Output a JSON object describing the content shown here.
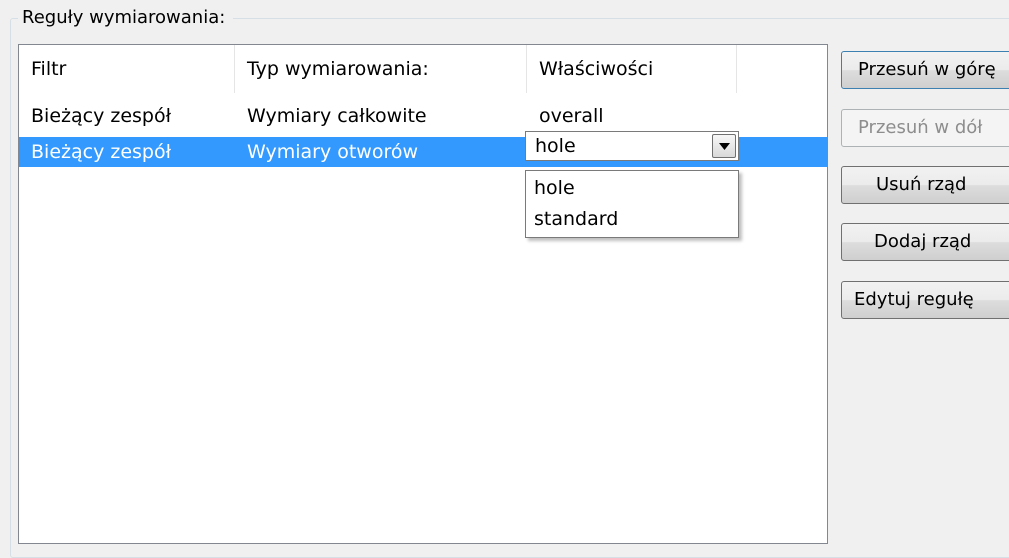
{
  "group": {
    "title": "Reguły wymiarowania:"
  },
  "table": {
    "columns": [
      "Filtr",
      "Typ wymiarowania:",
      "Właściwości"
    ],
    "rows": [
      {
        "filter": "Bieżący zespół",
        "type": "Wymiary całkowite",
        "properties": "overall",
        "selected": false
      },
      {
        "filter": "Bieżący zespół",
        "type": "Wymiary otworów",
        "properties": "hole",
        "selected": true
      }
    ]
  },
  "dropdown": {
    "selected": "hole",
    "options": [
      "hole",
      "standard"
    ]
  },
  "buttons": {
    "move_up": "Przesuń w górę",
    "move_down": "Przesuń w dół",
    "delete_row": "Usuń rząd",
    "add_row": "Dodaj rząd",
    "edit_rule": "Edytuj regułę"
  },
  "colors": {
    "selection": "#3399ff",
    "background": "#f0f0f0"
  }
}
